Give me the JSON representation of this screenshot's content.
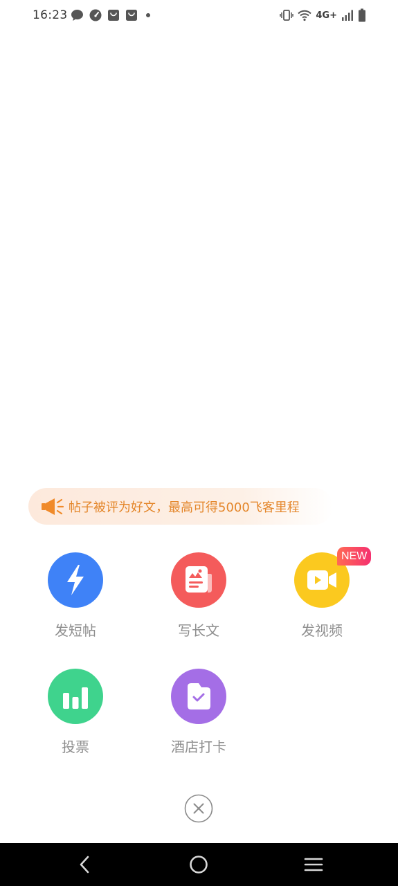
{
  "status_bar": {
    "time": "16:23",
    "network": "4G+",
    "icons": [
      "chat-bubble-icon",
      "speedometer-icon",
      "shopping-bag-icon",
      "shopping-bag-icon",
      "dot-icon",
      "vibrate-icon",
      "wifi-icon",
      "signal-icon",
      "battery-icon"
    ]
  },
  "notice": {
    "icon": "megaphone-icon",
    "text": "帖子被评为好文，最高可得5000飞客里程",
    "color": "#e4862a"
  },
  "actions": [
    {
      "label": "发短帖",
      "icon": "lightning-icon",
      "color": "#3f82f7"
    },
    {
      "label": "写长文",
      "icon": "article-icon",
      "color": "#f45b5b"
    },
    {
      "label": "发视频",
      "icon": "video-camera-icon",
      "color": "#fbc91f",
      "badge": "NEW"
    },
    {
      "label": "投票",
      "icon": "bar-chart-icon",
      "color": "#3fd38d"
    },
    {
      "label": "酒店打卡",
      "icon": "check-in-icon",
      "color": "#a46ee6"
    }
  ],
  "close": {
    "icon": "close-icon"
  },
  "nav": {
    "back": "back-icon",
    "home": "home-icon",
    "menu": "menu-icon"
  }
}
